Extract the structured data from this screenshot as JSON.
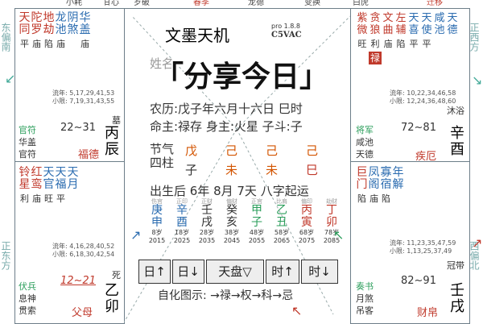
{
  "side": {
    "left_top": "东偏南",
    "left_bottom": "正东方",
    "right_top": "正西方",
    "right_bottom": "西偏北"
  },
  "top_partials": [
    "小耗",
    "甘心",
    "岁破",
    "春季",
    "龙德",
    "变换",
    "白虎",
    "迁移"
  ],
  "center": {
    "title": "文墨天机",
    "version": "pro 1.8.8",
    "tag": "C5VAC",
    "line_a": "姓名:",
    "line_b": "农历:戊子年六月十六日 巳时",
    "line_c": "命主:禄存 身主:火星 子斗:子",
    "jieqi_label": "节气",
    "sizhu_label": "四柱",
    "pillars_top": [
      "戊",
      "己",
      "己",
      "己"
    ],
    "pillars_bottom": [
      "子",
      "未",
      "未",
      "巳"
    ],
    "birth": "出生后 6年 8月 7天 八字起运",
    "dayun_header": [
      "伤官",
      "正印",
      "正财",
      "偏财",
      "正官",
      "比肩",
      "偏印",
      "劫财"
    ],
    "dayun_top": [
      "庚",
      "辛",
      "壬",
      "癸",
      "甲",
      "乙",
      "丙",
      "丁"
    ],
    "dayun_bottom": [
      "申",
      "酉",
      "戌",
      "亥",
      "子",
      "丑",
      "寅",
      "卯"
    ],
    "ages": [
      "8岁",
      "18岁",
      "28岁",
      "38岁",
      "48岁",
      "58岁",
      "68岁",
      "78岁"
    ],
    "years": [
      "2015",
      "2025",
      "2035",
      "2045",
      "2055",
      "2065",
      "2075",
      "2085"
    ],
    "buttons": [
      "日↑",
      "日↓",
      "天盘▽",
      "时↑",
      "时↓"
    ],
    "legend": "自化图示: →禄→权→科→忌"
  },
  "banner": "「分享今日」",
  "palaces": {
    "top_left": {
      "stars": [
        "天",
        "陀",
        "地",
        "龙",
        "阴",
        "华"
      ],
      "stars2": [
        "同",
        "罗",
        "劫",
        "池",
        "煞",
        "盖"
      ],
      "bright": [
        "平",
        "庙",
        "陷",
        "庙",
        "",
        "庙"
      ],
      "liunian": "流年: 5,17,29,41,53",
      "xiaoxian": "小限: 7,19,31,43,55",
      "god": "官符",
      "sub1": "华盖",
      "sub2": "官符",
      "range": "22~31",
      "life": "墓",
      "palace_name": "福德",
      "ganzhi": "丙辰"
    },
    "mid_left": {
      "stars": [
        "铃",
        "红",
        "天",
        "天",
        "天"
      ],
      "stars2": [
        "星",
        "鸾",
        "官",
        "福",
        "月"
      ],
      "bright": [
        "利",
        "庙",
        "旺",
        "平",
        ""
      ],
      "liunian": "流年: 4,16,28,40,52",
      "xiaoxian": "小限: 6,18,30,42,54",
      "god": "伏兵",
      "sub1": "息神",
      "sub2": "贯索",
      "range": "12~21",
      "life": "死",
      "palace_name": "父母",
      "ganzhi": "乙卯"
    },
    "top_right": {
      "stars": [
        "紫",
        "贪",
        "文",
        "左",
        "天",
        "天",
        "咸",
        "天"
      ],
      "stars2": [
        "微",
        "狼",
        "曲",
        "辅",
        "喜",
        "使",
        "池",
        "德"
      ],
      "bright": [
        "旺",
        "利",
        "庙",
        "陷",
        "平",
        "平",
        "",
        ""
      ],
      "hua": "禄",
      "liunian": "流年: 10,22,34,46,58",
      "xiaoxian": "小限: 12,24,36,48,60",
      "god": "将军",
      "sub1": "咸池",
      "sub2": "天德",
      "range": "72~81",
      "life": "沐浴",
      "palace_name": "疾厄",
      "ganzhi": "辛酉"
    },
    "mid_right": {
      "stars": [
        "巨",
        "凤",
        "寡",
        "年"
      ],
      "stars2": [
        "门",
        "阁",
        "宿",
        "解"
      ],
      "bright": [
        "陷",
        "庙",
        "陷",
        ""
      ],
      "liunian": "流年: 11,23,35,47,59",
      "xiaoxian": "小限: 1,13,25,37,49",
      "god": "奏书",
      "sub1": "月煞",
      "sub2": "吊客",
      "range": "82~91",
      "life": "冠带",
      "palace_name": "财帛",
      "ganzhi": "壬戌"
    }
  },
  "colors": {
    "red": "#c0392b",
    "green": "#2a9d5a",
    "blue": "#2b6cb0",
    "orange": "#d35400"
  }
}
